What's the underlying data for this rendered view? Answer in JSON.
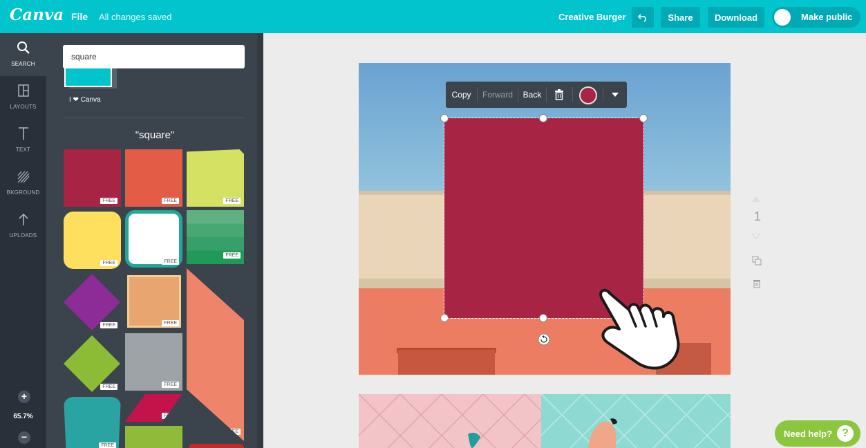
{
  "app": {
    "logo": "Canva",
    "file_menu": "File",
    "save_status": "All changes saved",
    "design_title": "Creative Burger",
    "share_label": "Share",
    "download_label": "Download",
    "make_public_label": "Make public",
    "accent_color": "#01c4cc"
  },
  "rail": {
    "items": [
      {
        "label": "SEARCH",
        "icon": "search-icon"
      },
      {
        "label": "LAYOUTS",
        "icon": "layouts-icon"
      },
      {
        "label": "TEXT",
        "icon": "text-icon"
      },
      {
        "label": "BKGROUND",
        "icon": "background-icon"
      },
      {
        "label": "UPLOADS",
        "icon": "upload-icon"
      }
    ],
    "zoom_level": "65.7%",
    "zoom_in": "+",
    "zoom_out": "−"
  },
  "panel": {
    "search_value": "square",
    "previous_section_label": "I ❤ Canva",
    "results_title": "\"square\"",
    "free_badge": "FREE",
    "result_colors": [
      "#a72444",
      "#e35d46",
      "#d4e163",
      "#ffdf5e",
      "#ffffff",
      "#3aa36b",
      "#8e2c97",
      "#e9a56f",
      "#ee846a",
      "#8cbc35",
      "#9ea3a8",
      "#2aa3a3",
      "#c3134a",
      "#8fba3a"
    ]
  },
  "toolbar": {
    "copy": "Copy",
    "forward": "Forward",
    "back": "Back",
    "selected_color": "#a72444"
  },
  "canvas": {
    "page_number": "1"
  },
  "help": {
    "label": "Need help?",
    "icon_glyph": "?"
  }
}
